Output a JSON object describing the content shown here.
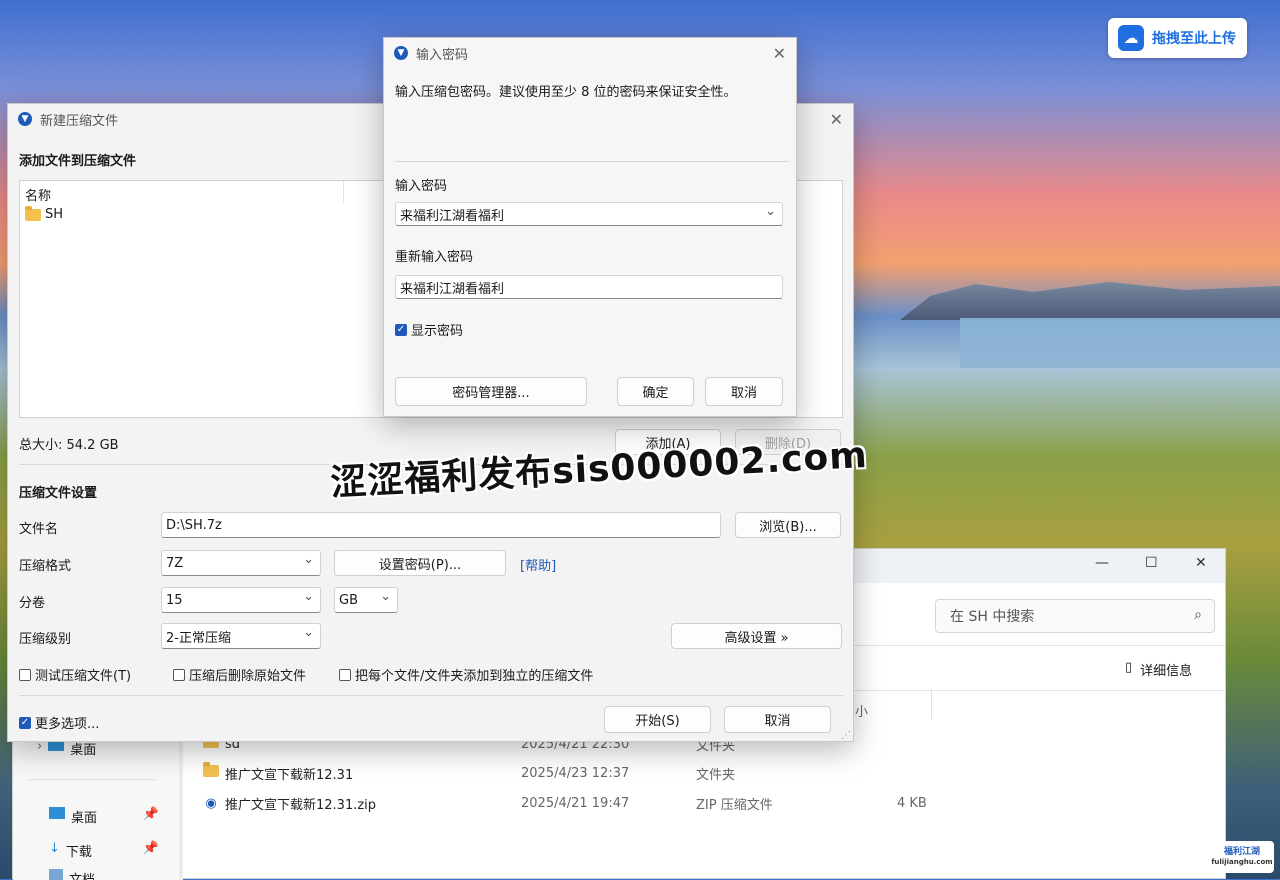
{
  "upload": {
    "label": "拖拽至此上传"
  },
  "archive": {
    "title": "新建压缩文件",
    "section_add": "添加文件到压缩文件",
    "list_header": "名称",
    "items": [
      "SH"
    ],
    "total_size": "总大小: 54.2 GB",
    "add_btn": "添加(A)",
    "delete_btn": "删除(D)",
    "section_settings": "压缩文件设置",
    "filename_label": "文件名",
    "filename_value": "D:\\SH.7z",
    "browse_btn": "浏览(B)...",
    "format_label": "压缩格式",
    "format_value": "7Z",
    "set_password_btn": "设置密码(P)...",
    "help_link": "[帮助]",
    "split_label": "分卷",
    "split_value": "15",
    "split_unit": "GB",
    "level_label": "压缩级别",
    "level_value": "2-正常压缩",
    "advanced_btn": "高级设置 »",
    "opt_test": "测试压缩文件(T)",
    "opt_delete": "压缩后删除原始文件",
    "opt_separate": "把每个文件/文件夹添加到独立的压缩文件",
    "more_options": "更多选项...",
    "start_btn": "开始(S)",
    "cancel_btn": "取消"
  },
  "password": {
    "title": "输入密码",
    "description": "输入压缩包密码。建议使用至少 8 位的密码来保证安全性。",
    "enter_label": "输入密码",
    "enter_value": "来福利江湖看福利",
    "reenter_label": "重新输入密码",
    "reenter_value": "来福利江湖看福利",
    "show_password": "显示密码",
    "manager_btn": "密码管理器...",
    "ok_btn": "确定",
    "cancel_btn": "取消"
  },
  "explorer": {
    "search_placeholder": "在 SH 中搜索",
    "details_btn": "详细信息",
    "col_size_partial": "小",
    "nav": [
      {
        "label": "桌面"
      },
      {
        "label": "桌面"
      },
      {
        "label": "下载"
      },
      {
        "label": "文档"
      }
    ],
    "rows": [
      {
        "name": "sd",
        "date": "2025/4/21 22:30",
        "type": "文件夹",
        "size": ""
      },
      {
        "name": "推广文宣下载新12.31",
        "date": "2025/4/23 12:37",
        "type": "文件夹",
        "size": ""
      },
      {
        "name": "推广文宣下载新12.31.zip",
        "date": "2025/4/21 19:47",
        "type": "ZIP 压缩文件",
        "size": "4 KB"
      }
    ]
  },
  "watermark": "涩涩福利发布sis000002.com",
  "corner_logo": {
    "top": "福利江湖",
    "bottom": "fulijianghu.com"
  }
}
